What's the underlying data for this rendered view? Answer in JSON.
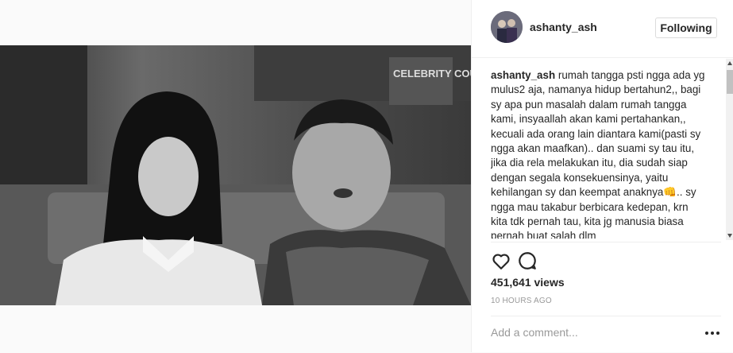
{
  "post": {
    "username": "ashanty_ash",
    "follow_label": "Following",
    "caption_username": "ashanty_ash",
    "caption_text": "rumah tangga psti ngga ada yg mulus2 aja, namanya hidup bertahun2,, bagi sy apa pun masalah dalam rumah tangga kami, insyaallah akan kami pertahankan,, kecuali ada orang lain diantara kami(pasti sy ngga akan maafkan).. dan suami sy tau itu, jika dia rela melakukan itu, dia sudah siap dengan segala konsekuensinya, yaitu kehilangan sy dan keempat anaknya👊.. sy ngga mau takabur berbicara kedepan, krn kita tdk pernah tau, kita jg manusia biasa pernah buat salah dlm",
    "views": "451,641 views",
    "timestamp": "10 HOURS AGO",
    "comment_placeholder": "Add a comment...",
    "video_overlay_text": "CELEBRITY COUPLE"
  },
  "icons": {
    "like": "heart-icon",
    "comment": "comment-bubble-icon",
    "more": "more-options-icon"
  }
}
